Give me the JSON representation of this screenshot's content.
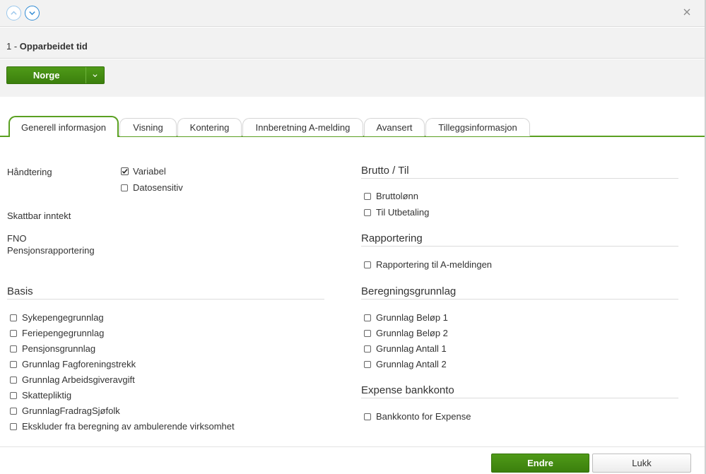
{
  "header": {
    "nav_up_icon": "chevron-up-icon",
    "nav_down_icon": "chevron-down-icon",
    "close_icon": "close-icon",
    "title_number": "1 - ",
    "title_name": "Opparbeidet tid"
  },
  "action": {
    "country_label": "Norge",
    "accent": "#3f8a10"
  },
  "tabs": [
    {
      "label": "Generell informasjon",
      "active": true
    },
    {
      "label": "Visning",
      "active": false
    },
    {
      "label": "Kontering",
      "active": false
    },
    {
      "label": "Innberetning A-melding",
      "active": false
    },
    {
      "label": "Avansert",
      "active": false
    },
    {
      "label": "Tilleggsinformasjon",
      "active": false
    }
  ],
  "left": {
    "handtering_label": "Håndtering",
    "handtering_options": [
      {
        "label": "Variabel",
        "checked": true
      },
      {
        "label": "Datosensitiv",
        "checked": false
      }
    ],
    "skattbar_label": "Skattbar inntekt",
    "fno_label": "FNO",
    "pensjon_label": "Pensjonsrapportering",
    "basis_title": "Basis",
    "basis_items": [
      {
        "label": "Sykepengegrunnlag",
        "checked": false
      },
      {
        "label": "Feriepengegrunnlag",
        "checked": false
      },
      {
        "label": "Pensjonsgrunnlag",
        "checked": false
      },
      {
        "label": "Grunnlag Fagforeningstrekk",
        "checked": false
      },
      {
        "label": "Grunnlag Arbeidsgiveravgift",
        "checked": false
      },
      {
        "label": "Skattepliktig",
        "checked": false
      },
      {
        "label": "GrunnlagFradragSjøfolk",
        "checked": false
      },
      {
        "label": "Ekskluder fra beregning av ambulerende virksomhet",
        "checked": false
      }
    ]
  },
  "right": {
    "brutto_title": "Brutto / Til",
    "brutto_items": [
      {
        "label": "Bruttolønn",
        "checked": false
      },
      {
        "label": "Til Utbetaling",
        "checked": false
      }
    ],
    "rapport_title": "Rapportering",
    "rapport_items": [
      {
        "label": "Rapportering til A-meldingen",
        "checked": false
      }
    ],
    "beregning_title": "Beregningsgrunnlag",
    "beregning_items": [
      {
        "label": "Grunnlag Beløp 1",
        "checked": false
      },
      {
        "label": "Grunnlag Beløp 2",
        "checked": false
      },
      {
        "label": "Grunnlag Antall 1",
        "checked": false
      },
      {
        "label": "Grunnlag Antall 2",
        "checked": false
      }
    ],
    "expense_title": "Expense bankkonto",
    "expense_items": [
      {
        "label": "Bankkonto for Expense",
        "checked": false
      }
    ]
  },
  "footer": {
    "save_label": "Endre",
    "close_label": "Lukk"
  }
}
